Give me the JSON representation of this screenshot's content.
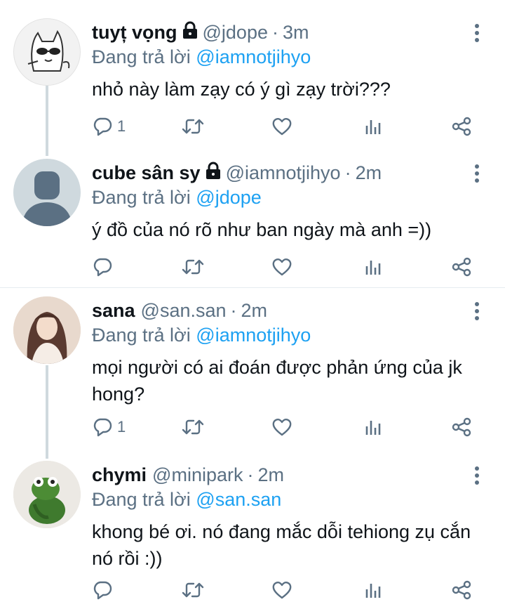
{
  "tweets": [
    {
      "name": "tuyț vọng",
      "locked": true,
      "handle": "@jdope",
      "separator": "·",
      "time": "3m",
      "replying_prefix": "Đang trả lời",
      "replying_to": "@iamnotjihyo",
      "text": "nhỏ này làm zạy có ý gì zạy trời???",
      "reply_count": "1"
    },
    {
      "name": "cube sân sy",
      "locked": true,
      "handle": "@iamnotjihyo",
      "separator": "·",
      "time": "2m",
      "replying_prefix": "Đang trả lời",
      "replying_to": "@jdope",
      "text": "ý đồ của nó rõ như ban ngày mà anh =))",
      "reply_count": ""
    },
    {
      "name": "sana",
      "locked": false,
      "handle": "@san.san",
      "separator": "·",
      "time": "2m",
      "replying_prefix": "Đang trả lời",
      "replying_to": "@iamnotjihyo",
      "text": "mọi người có ai đoán được phản ứng của jk hong?",
      "reply_count": "1"
    },
    {
      "name": "chymi",
      "locked": false,
      "handle": "@minipark",
      "separator": "·",
      "time": "2m",
      "replying_prefix": "Đang trả lời",
      "replying_to": "@san.san",
      "text": "khong bé ơi. nó đang mắc dỗi tehiong zụ cắn nó rồi :))",
      "reply_count": ""
    }
  ],
  "icons": {
    "reply": "reply-icon",
    "retweet": "retweet-icon",
    "like": "like-icon",
    "analytics": "analytics-icon",
    "share": "share-icon",
    "more": "more-options-icon",
    "lock": "lock-icon"
  },
  "colors": {
    "mention": "#1da1f2",
    "secondary_text": "#5b7083",
    "thread_line": "#cfd9de"
  }
}
